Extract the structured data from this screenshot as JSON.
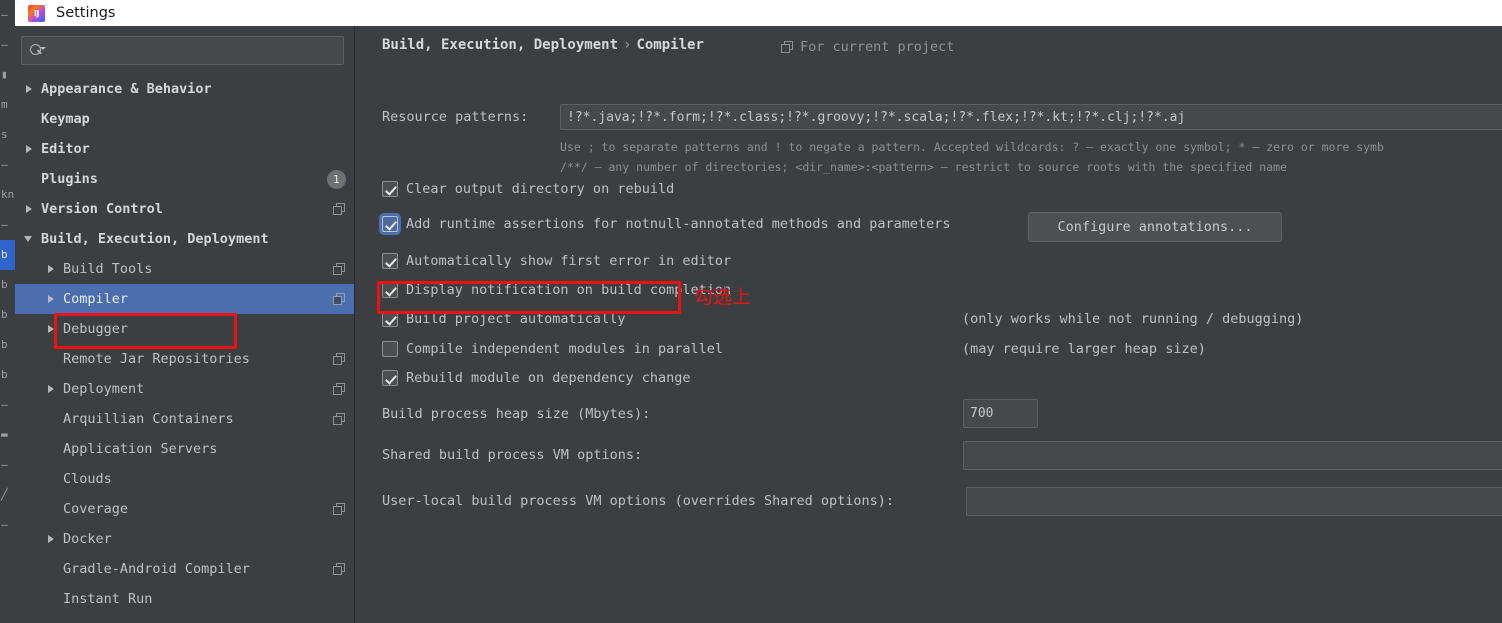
{
  "window": {
    "title": "Settings",
    "logo_icon": "intellij-idea-icon"
  },
  "sidebar": {
    "search": {
      "value": "",
      "placeholder": ""
    },
    "items": [
      {
        "label": "Appearance & Behavior",
        "arrow": "collapsed",
        "indent": 0,
        "bold": true,
        "badge": "",
        "scope_icon": false
      },
      {
        "label": "Keymap",
        "arrow": "none",
        "indent": 0,
        "bold": true,
        "badge": "",
        "scope_icon": false
      },
      {
        "label": "Editor",
        "arrow": "collapsed",
        "indent": 0,
        "bold": true,
        "badge": "",
        "scope_icon": false
      },
      {
        "label": "Plugins",
        "arrow": "none",
        "indent": 0,
        "bold": true,
        "badge": "1",
        "scope_icon": false
      },
      {
        "label": "Version Control",
        "arrow": "collapsed",
        "indent": 0,
        "bold": true,
        "badge": "",
        "scope_icon": true
      },
      {
        "label": "Build, Execution, Deployment",
        "arrow": "expanded",
        "indent": 0,
        "bold": true,
        "badge": "",
        "scope_icon": false
      },
      {
        "label": "Build Tools",
        "arrow": "collapsed",
        "indent": 1,
        "bold": false,
        "badge": "",
        "scope_icon": true
      },
      {
        "label": "Compiler",
        "arrow": "collapsed",
        "indent": 1,
        "bold": false,
        "badge": "",
        "scope_icon": true,
        "selected": true
      },
      {
        "label": "Debugger",
        "arrow": "collapsed",
        "indent": 1,
        "bold": false,
        "badge": "",
        "scope_icon": false
      },
      {
        "label": "Remote Jar Repositories",
        "arrow": "none",
        "indent": 1,
        "bold": false,
        "badge": "",
        "scope_icon": true
      },
      {
        "label": "Deployment",
        "arrow": "collapsed",
        "indent": 1,
        "bold": false,
        "badge": "",
        "scope_icon": true
      },
      {
        "label": "Arquillian Containers",
        "arrow": "none",
        "indent": 1,
        "bold": false,
        "badge": "",
        "scope_icon": true
      },
      {
        "label": "Application Servers",
        "arrow": "none",
        "indent": 1,
        "bold": false,
        "badge": "",
        "scope_icon": false
      },
      {
        "label": "Clouds",
        "arrow": "none",
        "indent": 1,
        "bold": false,
        "badge": "",
        "scope_icon": false
      },
      {
        "label": "Coverage",
        "arrow": "none",
        "indent": 1,
        "bold": false,
        "badge": "",
        "scope_icon": true
      },
      {
        "label": "Docker",
        "arrow": "collapsed",
        "indent": 1,
        "bold": false,
        "badge": "",
        "scope_icon": false
      },
      {
        "label": "Gradle-Android Compiler",
        "arrow": "none",
        "indent": 1,
        "bold": false,
        "badge": "",
        "scope_icon": true
      },
      {
        "label": "Instant Run",
        "arrow": "none",
        "indent": 1,
        "bold": false,
        "badge": "",
        "scope_icon": false
      }
    ]
  },
  "main": {
    "breadcrumb": {
      "parent": "Build, Execution, Deployment",
      "separator": "›",
      "current": "Compiler"
    },
    "for_current_project": "For current project",
    "resource_patterns": {
      "label": "Resource patterns:",
      "value": "!?*.java;!?*.form;!?*.class;!?*.groovy;!?*.scala;!?*.flex;!?*.kt;!?*.clj;!?*.aj"
    },
    "patterns_hint_line1": "Use ; to separate patterns and ! to negate a pattern. Accepted wildcards: ? — exactly one symbol; * — zero or more symb",
    "patterns_hint_line2": "/**/ — any number of directories; <dir_name>:<pattern> — restrict to source roots with the specified name",
    "checkboxes": [
      {
        "label": "Clear output directory on rebuild",
        "checked": true,
        "focused": false
      },
      {
        "label": "Add runtime assertions for notnull-annotated methods and parameters",
        "checked": true,
        "focused": true
      },
      {
        "label": "Automatically show first error in editor",
        "checked": true,
        "focused": false
      },
      {
        "label": "Display notification on build completion",
        "checked": true,
        "focused": false
      },
      {
        "label": "Build project automatically",
        "checked": true,
        "focused": false
      },
      {
        "label": "Compile independent modules in parallel",
        "checked": false,
        "focused": false
      },
      {
        "label": "Rebuild module on dependency change",
        "checked": true,
        "focused": false
      }
    ],
    "configure_annotations_button": "Configure annotations...",
    "note_build_auto": "(only works while not running / debugging)",
    "note_parallel": "(may require larger heap size)",
    "heap_size": {
      "label": "Build process heap size (Mbytes):",
      "value": "700"
    },
    "shared_vm": {
      "label": "Shared build process VM options:",
      "value": ""
    },
    "user_local_vm": {
      "label": "User-local build process VM options (overrides Shared options):",
      "value": ""
    }
  },
  "annotations": {
    "chinese_note": "勾选上",
    "color": "#ee1111"
  },
  "background_strip": [
    "–",
    "–",
    "▮",
    "m",
    "s",
    "–",
    "kn",
    "–",
    "b",
    "b",
    "b",
    "b",
    "b",
    "–",
    "▬",
    "–",
    "╱",
    "–"
  ]
}
